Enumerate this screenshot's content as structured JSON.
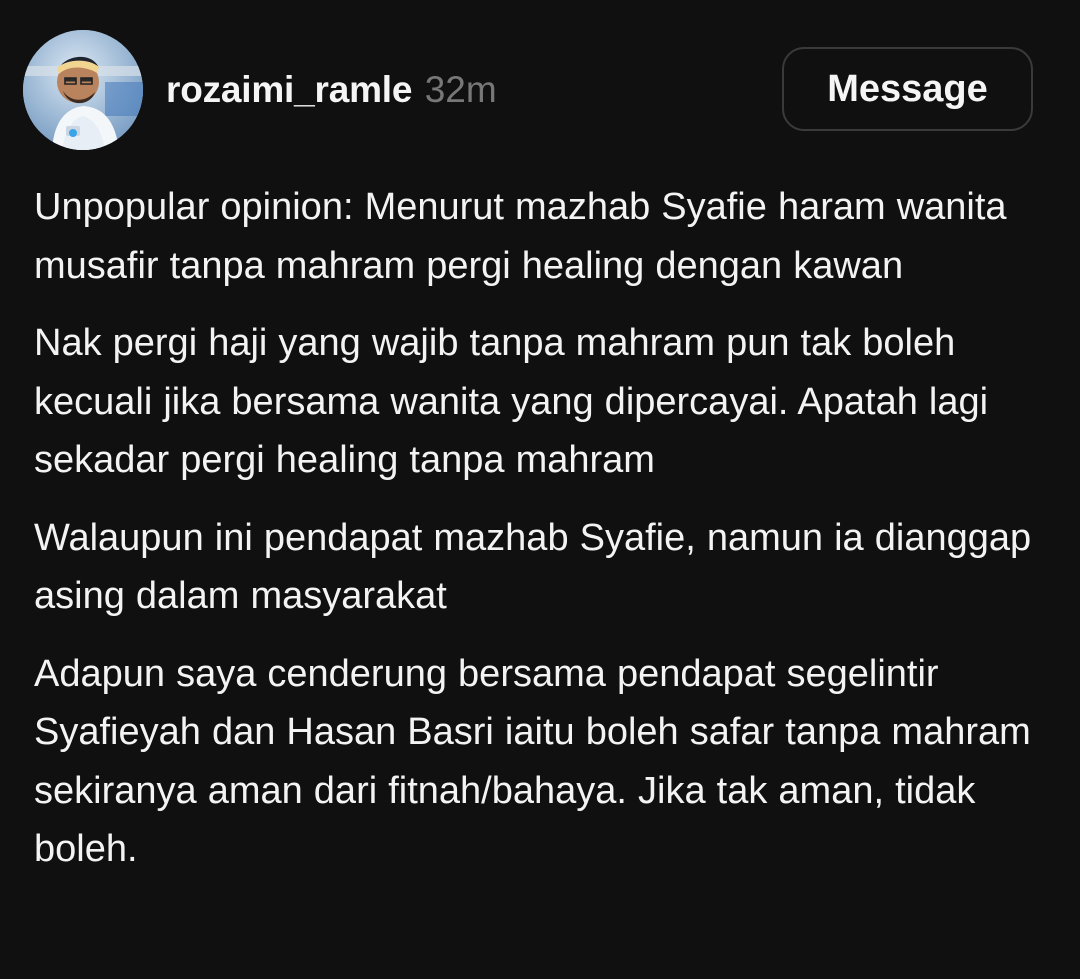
{
  "author": {
    "username": "rozaimi_ramle",
    "timestamp": "32m",
    "avatar_icon": "profile-photo-avatar"
  },
  "actions": {
    "message_label": "Message"
  },
  "post": {
    "paragraphs": [
      "Unpopular opinion:  Menurut mazhab Syafie haram wanita musafir tanpa mahram pergi healing dengan kawan",
      "Nak pergi haji yang wajib tanpa mahram pun tak boleh kecuali jika bersama wanita yang dipercayai. Apatah lagi sekadar pergi healing tanpa mahram",
      "Walaupun ini pendapat mazhab Syafie, namun ia dianggap asing dalam masyarakat",
      "Adapun saya cenderung bersama pendapat segelintir Syafieyah dan Hasan Basri iaitu boleh safar tanpa mahram sekiranya aman dari fitnah/bahaya. Jika tak aman, tidak boleh."
    ]
  },
  "colors": {
    "background": "#101010",
    "text": "#f3f3f3",
    "muted": "#777777",
    "button_border": "#3a3a3a"
  }
}
